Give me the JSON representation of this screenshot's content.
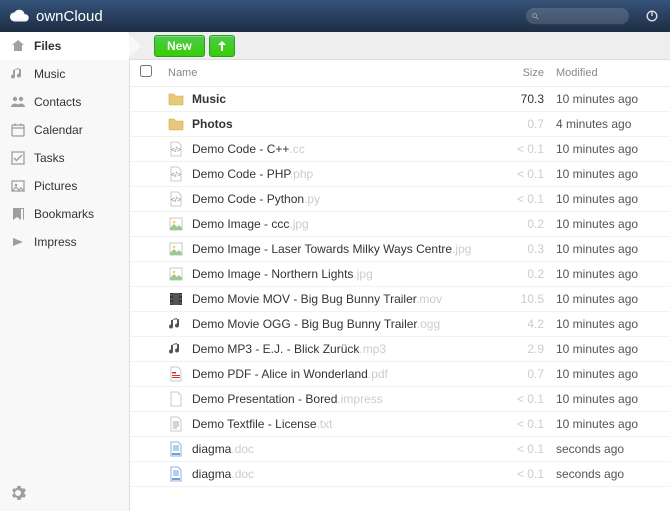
{
  "app_name": "ownCloud",
  "search": {
    "placeholder": ""
  },
  "sidebar": {
    "items": [
      {
        "label": "Files",
        "icon": "home-icon",
        "active": true
      },
      {
        "label": "Music",
        "icon": "music-icon",
        "active": false
      },
      {
        "label": "Contacts",
        "icon": "contacts-icon",
        "active": false
      },
      {
        "label": "Calendar",
        "icon": "calendar-icon",
        "active": false
      },
      {
        "label": "Tasks",
        "icon": "tasks-icon",
        "active": false
      },
      {
        "label": "Pictures",
        "icon": "pictures-icon",
        "active": false
      },
      {
        "label": "Bookmarks",
        "icon": "bookmarks-icon",
        "active": false
      },
      {
        "label": "Impress",
        "icon": "impress-icon",
        "active": false
      }
    ]
  },
  "controls": {
    "new_label": "New"
  },
  "columns": {
    "name": "Name",
    "size": "Size",
    "modified": "Modified"
  },
  "files": [
    {
      "type": "folder",
      "name": "Music",
      "ext": "",
      "size": "70.3",
      "size_tone": "dark",
      "modified": "10 minutes ago",
      "bold": true
    },
    {
      "type": "folder",
      "name": "Photos",
      "ext": "",
      "size": "0.7",
      "size_tone": "light",
      "modified": "4 minutes ago",
      "bold": true
    },
    {
      "type": "code",
      "name": "Demo Code - C++",
      "ext": ".cc",
      "size": "< 0.1",
      "size_tone": "light",
      "modified": "10 minutes ago",
      "bold": false
    },
    {
      "type": "code",
      "name": "Demo Code - PHP",
      "ext": ".php",
      "size": "< 0.1",
      "size_tone": "light",
      "modified": "10 minutes ago",
      "bold": false
    },
    {
      "type": "code",
      "name": "Demo Code - Python",
      "ext": ".py",
      "size": "< 0.1",
      "size_tone": "light",
      "modified": "10 minutes ago",
      "bold": false
    },
    {
      "type": "image",
      "name": "Demo Image - ccc",
      "ext": ".jpg",
      "size": "0.2",
      "size_tone": "light",
      "modified": "10 minutes ago",
      "bold": false
    },
    {
      "type": "image",
      "name": "Demo Image - Laser Towards Milky Ways Centre",
      "ext": ".jpg",
      "size": "0.3",
      "size_tone": "light",
      "modified": "10 minutes ago",
      "bold": false
    },
    {
      "type": "image",
      "name": "Demo Image - Northern Lights",
      "ext": ".jpg",
      "size": "0.2",
      "size_tone": "light",
      "modified": "10 minutes ago",
      "bold": false
    },
    {
      "type": "movie",
      "name": "Demo Movie MOV - Big Bug Bunny Trailer",
      "ext": ".mov",
      "size": "10.5",
      "size_tone": "light",
      "modified": "10 minutes ago",
      "bold": false
    },
    {
      "type": "audio",
      "name": "Demo Movie OGG - Big Bug Bunny Trailer",
      "ext": ".ogg",
      "size": "4.2",
      "size_tone": "light",
      "modified": "10 minutes ago",
      "bold": false
    },
    {
      "type": "audio",
      "name": "Demo MP3 - E.J. - Blick Zurück",
      "ext": ".mp3",
      "size": "2.9",
      "size_tone": "light",
      "modified": "10 minutes ago",
      "bold": false
    },
    {
      "type": "pdf",
      "name": "Demo PDF - Alice in Wonderland",
      "ext": ".pdf",
      "size": "0.7",
      "size_tone": "light",
      "modified": "10 minutes ago",
      "bold": false
    },
    {
      "type": "file",
      "name": "Demo Presentation - Bored",
      "ext": ".impress",
      "size": "< 0.1",
      "size_tone": "light",
      "modified": "10 minutes ago",
      "bold": false
    },
    {
      "type": "text",
      "name": "Demo Textfile - License",
      "ext": ".txt",
      "size": "< 0.1",
      "size_tone": "light",
      "modified": "10 minutes ago",
      "bold": false
    },
    {
      "type": "doc",
      "name": "diagma",
      "ext": ".doc",
      "size": "< 0.1",
      "size_tone": "light",
      "modified": "seconds ago",
      "bold": false
    },
    {
      "type": "doc",
      "name": "diagma",
      "ext": ".doc",
      "size": "< 0.1",
      "size_tone": "light",
      "modified": "seconds ago",
      "bold": false
    }
  ]
}
